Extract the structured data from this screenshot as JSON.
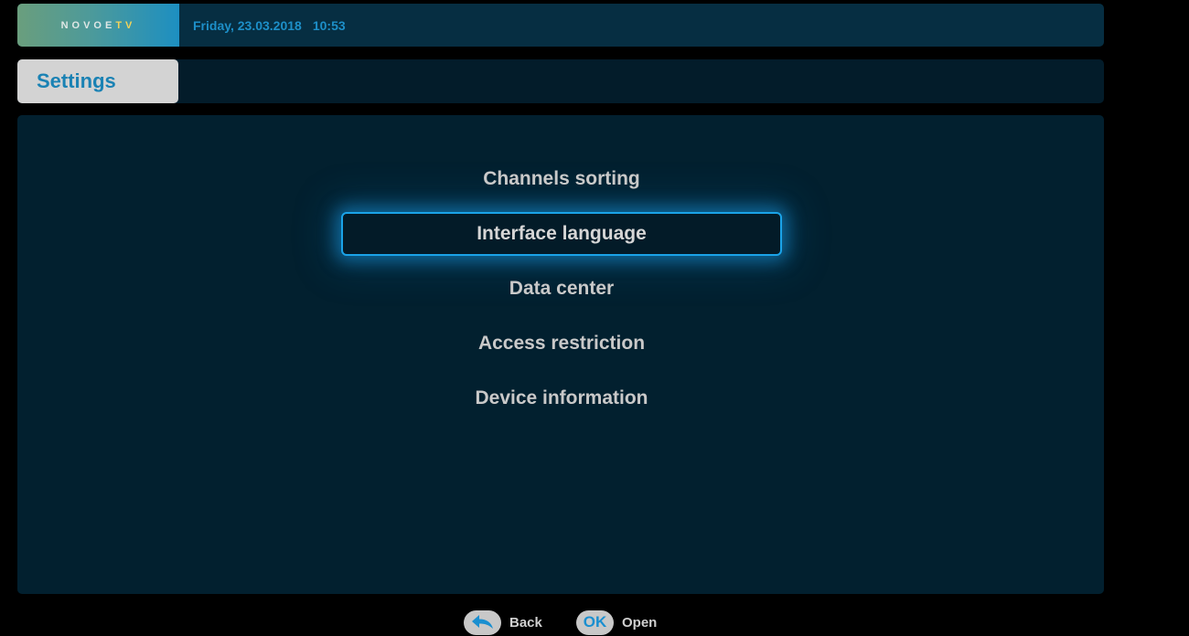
{
  "header": {
    "logo_part1": "NOVOE",
    "logo_part2": "TV",
    "date": "Friday, 23.03.2018",
    "time": "10:53"
  },
  "title": {
    "label": "Settings"
  },
  "menu": {
    "items": [
      {
        "label": "Channels sorting"
      },
      {
        "label": "Interface language"
      },
      {
        "label": "Data center"
      },
      {
        "label": "Access restriction"
      },
      {
        "label": "Device information"
      }
    ],
    "selected_label": "Interface language"
  },
  "hints": {
    "back_icon": "back-arrow-icon",
    "back_label": "Back",
    "ok_key": "OK",
    "ok_label": "Open"
  },
  "colors": {
    "accent": "#1d8fc8",
    "focus_glow": "#1aa3e8",
    "panel": "#02202f",
    "topbar": "#062e42"
  }
}
